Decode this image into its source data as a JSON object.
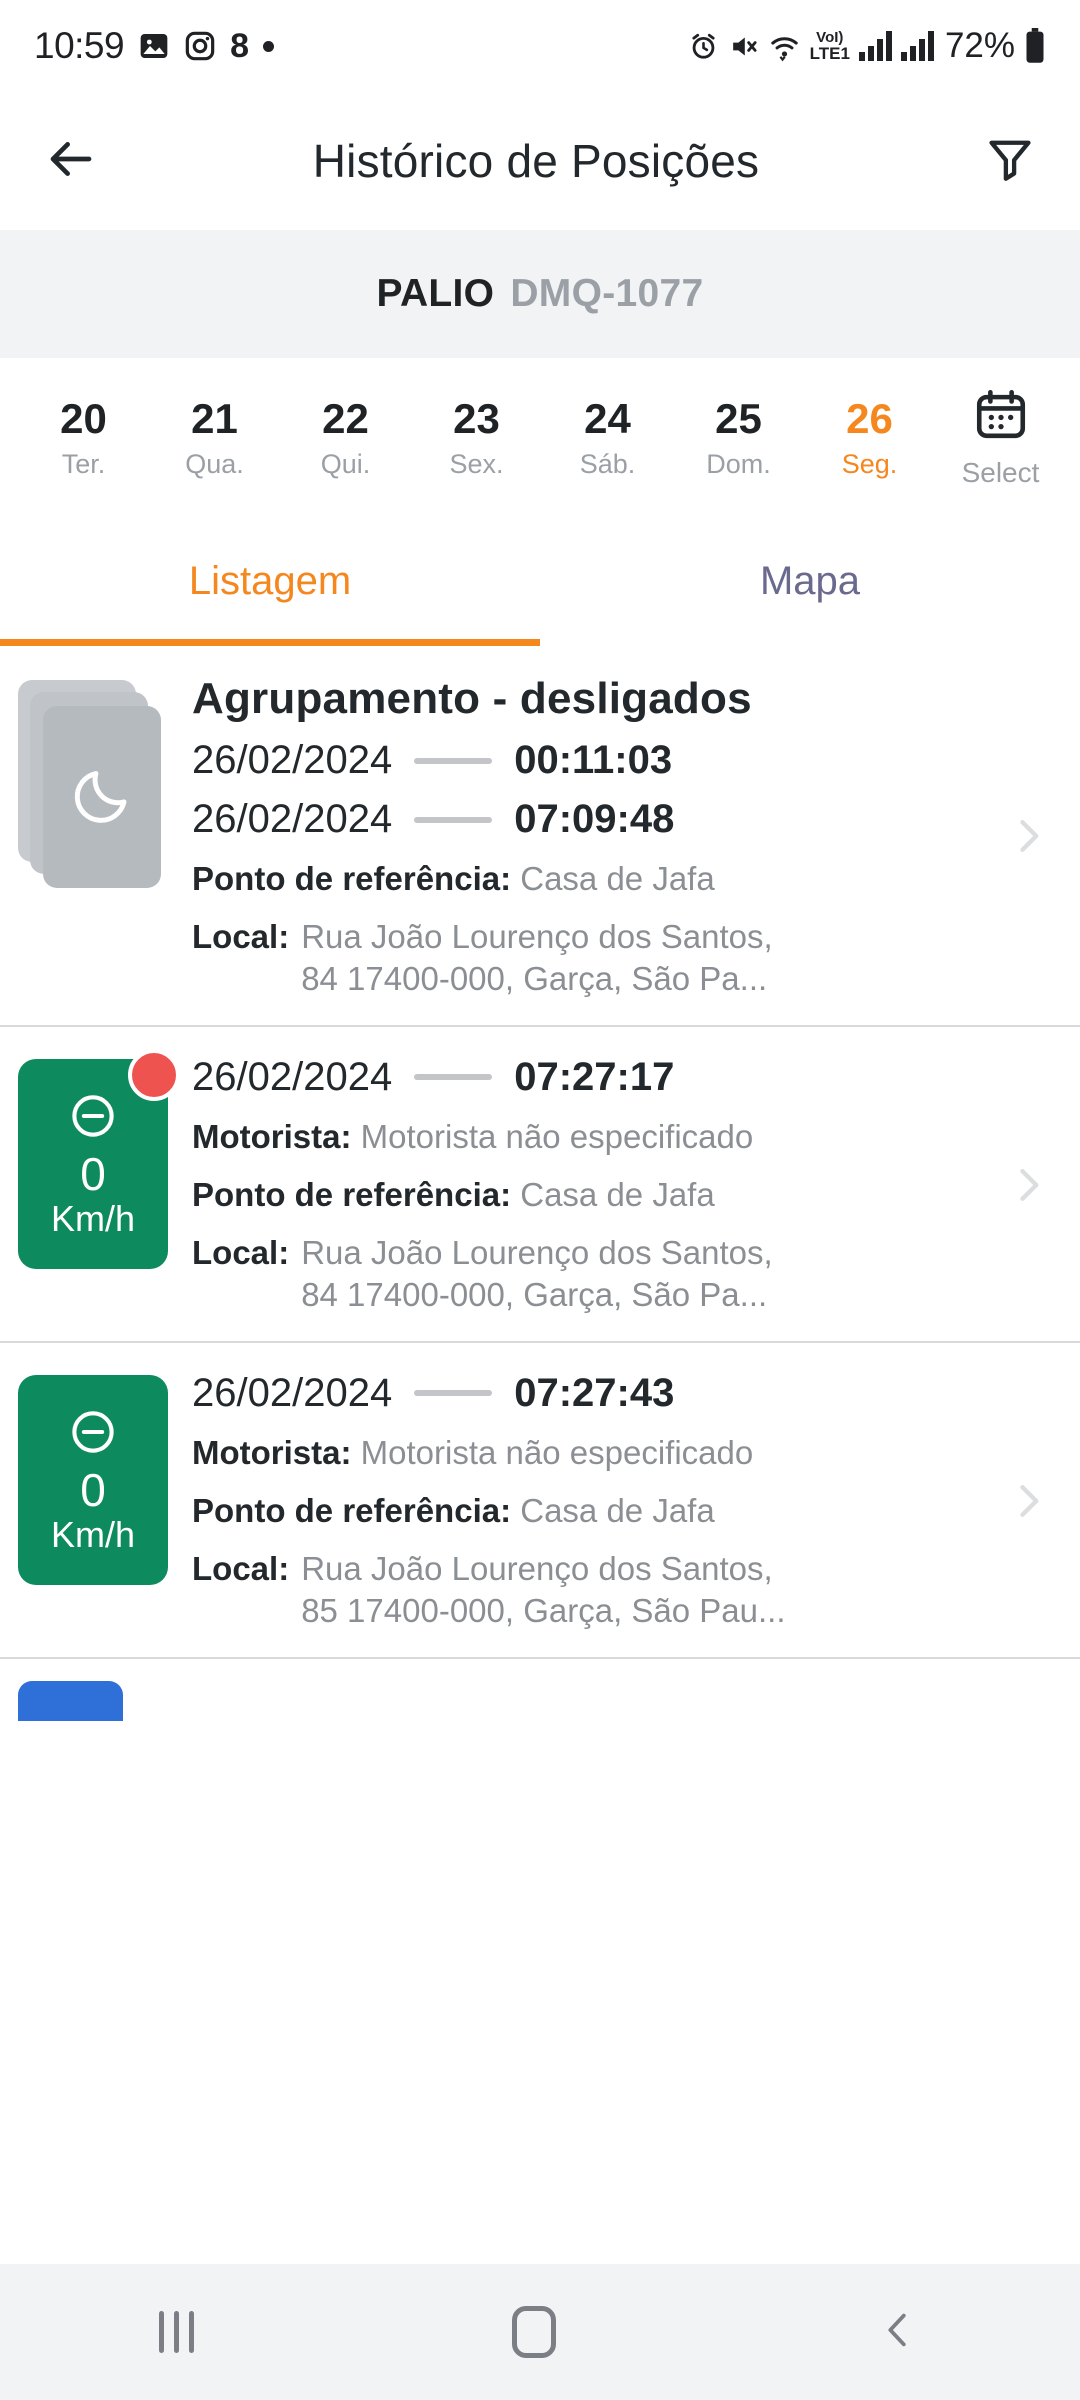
{
  "status_bar": {
    "time": "10:59",
    "notification_count": "8",
    "battery_percent": "72%",
    "network_label_top": "VoI)",
    "network_label_bottom": "LTE1",
    "icons": [
      "photos-icon",
      "instagram-icon",
      "notification-count",
      "more-dot",
      "alarm-icon",
      "mute-icon",
      "wifi-icon",
      "volte-icon",
      "signal-icon-1",
      "signal-icon-2",
      "battery-icon"
    ]
  },
  "app_bar": {
    "back_icon": "back-arrow-icon",
    "title": "Histórico de Posições",
    "filter_icon": "filter-funnel-icon"
  },
  "vehicle": {
    "name": "PALIO",
    "plate": "DMQ-1077"
  },
  "day_strip": {
    "days": [
      {
        "num": "20",
        "label": "Ter.",
        "selected": false
      },
      {
        "num": "21",
        "label": "Qua.",
        "selected": false
      },
      {
        "num": "22",
        "label": "Qui.",
        "selected": false
      },
      {
        "num": "23",
        "label": "Sex.",
        "selected": false
      },
      {
        "num": "24",
        "label": "Sáb.",
        "selected": false
      },
      {
        "num": "25",
        "label": "Dom.",
        "selected": false
      },
      {
        "num": "26",
        "label": "Seg.",
        "selected": true
      }
    ],
    "select": {
      "label": "Select",
      "icon": "calendar-icon"
    },
    "accent_color": "#f5871f"
  },
  "tabs": {
    "items": [
      {
        "label": "Listagem",
        "active": true
      },
      {
        "label": "Mapa",
        "active": false
      }
    ],
    "active_color": "#f5871f",
    "inactive_color": "#6a6a8e"
  },
  "labels": {
    "reference_point": "Ponto de referência:",
    "local": "Local:",
    "driver": "Motorista:"
  },
  "list": {
    "cards": [
      {
        "type": "grouped",
        "icon": "moon-icon",
        "title": "Agrupamento - desligados",
        "start_date": "26/02/2024",
        "start_time": "00:11:03",
        "end_date": "26/02/2024",
        "end_time": "07:09:48",
        "reference_point": "Casa de Jafa",
        "local_line1": "Rua João Lourenço dos Santos,",
        "local_line2": "84 17400-000, Garça, São Pa...",
        "chevron": "chevron-right-icon"
      },
      {
        "type": "position",
        "icon": "circle-minus-icon",
        "speed_value": "0",
        "speed_unit": "Km/h",
        "badge_color": "#0e8a5f",
        "alert_dot": true,
        "alert_color": "#ef5350",
        "date": "26/02/2024",
        "time": "07:27:17",
        "driver": "Motorista não especificado",
        "reference_point": "Casa de Jafa",
        "local_line1": "Rua João Lourenço dos Santos,",
        "local_line2": "84 17400-000, Garça, São Pa...",
        "chevron": "chevron-right-icon"
      },
      {
        "type": "position",
        "icon": "circle-minus-icon",
        "speed_value": "0",
        "speed_unit": "Km/h",
        "badge_color": "#0e8a5f",
        "alert_dot": false,
        "date": "26/02/2024",
        "time": "07:27:43",
        "driver": "Motorista não especificado",
        "reference_point": "Casa de Jafa",
        "local_line1": "Rua João Lourenço dos Santos,",
        "local_line2": "85 17400-000, Garça, São Pau...",
        "chevron": "chevron-right-icon"
      }
    ],
    "peek_badge_color": "#2f6fd8"
  },
  "nav_bar": {
    "recents": "recents-icon",
    "home": "home-icon",
    "back": "back-icon"
  }
}
